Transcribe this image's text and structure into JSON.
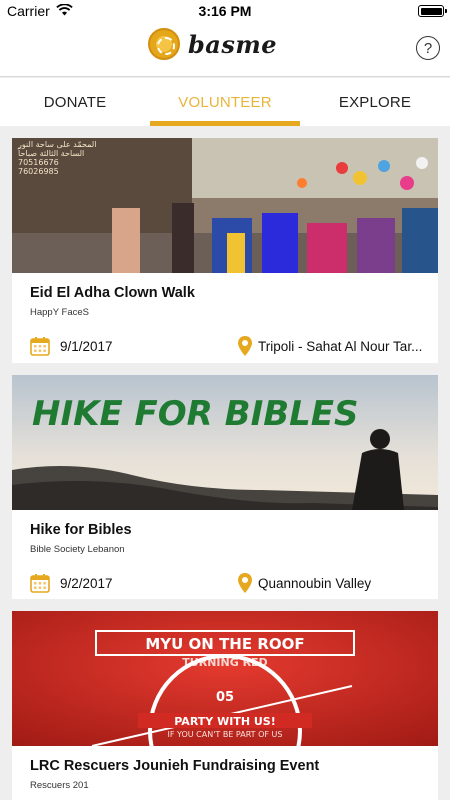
{
  "status_bar": {
    "carrier": "Carrier",
    "time": "3:16 PM"
  },
  "header": {
    "brand": "basme",
    "help_glyph": "?"
  },
  "tabs": [
    {
      "label": "DONATE",
      "active": false
    },
    {
      "label": "VOLUNTEER",
      "active": true
    },
    {
      "label": "EXPLORE",
      "active": false
    }
  ],
  "colors": {
    "accent": "#e6a81e",
    "accent_text": "#e8b53a"
  },
  "events": [
    {
      "title": "Eid El Adha Clown Walk",
      "organizer": "HappY FaceS",
      "date": "9/1/2017",
      "location": "Tripoli - Sahat Al Nour Tar...",
      "image_text": [
        "المحمّد على ساحة النور",
        "الساحة الثالثة صباحاً",
        "70516676",
        "76026985"
      ]
    },
    {
      "title": "Hike for Bibles",
      "organizer": "Bible Society Lebanon",
      "date": "9/2/2017",
      "location": "Quannoubin Valley",
      "image_text": [
        "HIKE FOR BIBLES"
      ]
    },
    {
      "title": "LRC Rescuers Jounieh Fundraising Event",
      "organizer": "Rescuers 201",
      "date": "",
      "location": "",
      "image_text": [
        "MYU ON THE ROOF",
        "TURNING RED",
        "05",
        "PARTY WITH US!",
        "IF YOU CAN'T BE PART OF US"
      ]
    }
  ],
  "icons": {
    "date": "calendar-icon",
    "location": "map-pin-icon",
    "help": "help-circle-icon"
  }
}
